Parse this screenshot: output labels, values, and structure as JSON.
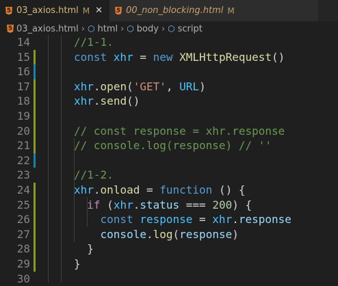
{
  "tabs": [
    {
      "label": "03_axios.html",
      "badge": "M",
      "icon": "html5-icon",
      "active": true
    },
    {
      "label": "00_non_blocking.html",
      "badge": "M",
      "icon": "html5-icon",
      "active": false
    }
  ],
  "breadcrumb": [
    "03_axios.html",
    "html",
    "body",
    "script"
  ],
  "colors": {
    "modified": "#8a9a2a",
    "added": "#1b81a8"
  },
  "lines": [
    {
      "n": "14",
      "g": "",
      "t": [
        [
          "comment",
          "//1-1."
        ]
      ]
    },
    {
      "n": "15",
      "g": "modified",
      "t": [
        [
          "kw",
          "const "
        ],
        [
          "var",
          "xhr"
        ],
        [
          "p",
          " = "
        ],
        [
          "kw",
          "new "
        ],
        [
          "fn",
          "XMLHttpRequest"
        ],
        [
          "p",
          "()"
        ]
      ]
    },
    {
      "n": "16",
      "g": "added",
      "t": []
    },
    {
      "n": "17",
      "g": "modified",
      "t": [
        [
          "var",
          "xhr"
        ],
        [
          "p",
          "."
        ],
        [
          "fn",
          "open"
        ],
        [
          "p",
          "("
        ],
        [
          "str",
          "'GET'"
        ],
        [
          "p",
          ", "
        ],
        [
          "var",
          "URL"
        ],
        [
          "p",
          ")"
        ]
      ]
    },
    {
      "n": "18",
      "g": "modified",
      "t": [
        [
          "var",
          "xhr"
        ],
        [
          "p",
          "."
        ],
        [
          "fn",
          "send"
        ],
        [
          "p",
          "()"
        ]
      ]
    },
    {
      "n": "19",
      "g": "modified",
      "t": []
    },
    {
      "n": "20",
      "g": "modified",
      "t": [
        [
          "comment",
          "// const response = xhr.response"
        ]
      ]
    },
    {
      "n": "21",
      "g": "modified",
      "t": [
        [
          "comment",
          "// console.log(response) // ''"
        ]
      ]
    },
    {
      "n": "22",
      "g": "added",
      "t": []
    },
    {
      "n": "23",
      "g": "",
      "t": [
        [
          "comment",
          "//1-2."
        ]
      ]
    },
    {
      "n": "24",
      "g": "modified",
      "t": [
        [
          "var",
          "xhr"
        ],
        [
          "p",
          "."
        ],
        [
          "fn",
          "onload"
        ],
        [
          "p",
          " = "
        ],
        [
          "kw",
          "function "
        ],
        [
          "p",
          "() {"
        ]
      ]
    },
    {
      "n": "25",
      "g": "modified",
      "t": [
        [
          "p",
          "  "
        ],
        [
          "ctl",
          "if "
        ],
        [
          "p",
          "("
        ],
        [
          "var",
          "xhr"
        ],
        [
          "p",
          "."
        ],
        [
          "prop",
          "status"
        ],
        [
          "p",
          " === "
        ],
        [
          "num",
          "200"
        ],
        [
          "p",
          ") {"
        ]
      ]
    },
    {
      "n": "26",
      "g": "modified",
      "t": [
        [
          "p",
          "    "
        ],
        [
          "kw",
          "const "
        ],
        [
          "var",
          "response"
        ],
        [
          "p",
          " = "
        ],
        [
          "var",
          "xhr"
        ],
        [
          "p",
          "."
        ],
        [
          "prop",
          "response"
        ]
      ]
    },
    {
      "n": "27",
      "g": "modified",
      "t": [
        [
          "p",
          "    "
        ],
        [
          "prop",
          "console"
        ],
        [
          "p",
          "."
        ],
        [
          "fn",
          "log"
        ],
        [
          "p",
          "("
        ],
        [
          "prop",
          "response"
        ],
        [
          "p",
          ")"
        ]
      ]
    },
    {
      "n": "28",
      "g": "modified",
      "t": [
        [
          "p",
          "  }"
        ]
      ]
    },
    {
      "n": "29",
      "g": "modified",
      "t": [
        [
          "p",
          "}"
        ]
      ]
    },
    {
      "n": "30",
      "g": "",
      "t": []
    }
  ]
}
